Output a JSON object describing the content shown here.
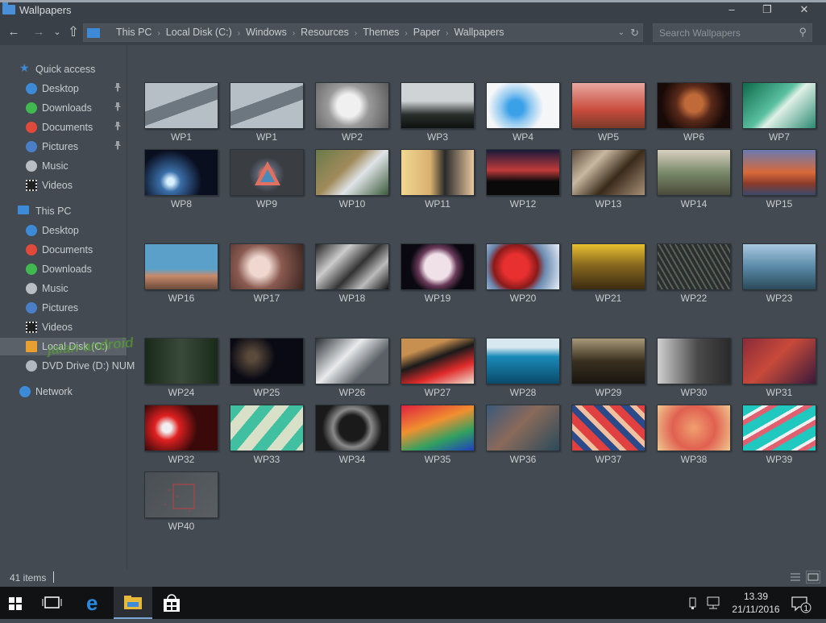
{
  "window": {
    "title": "Wallpapers",
    "minimize": "–",
    "maximize": "❐",
    "close": "✕"
  },
  "nav": {
    "back": "←",
    "forward": "→",
    "recent": "⌄",
    "up": "⇧"
  },
  "address": {
    "crumbs": [
      "This PC",
      "Local Disk (C:)",
      "Windows",
      "Resources",
      "Themes",
      "Paper",
      "Wallpapers"
    ],
    "dropdown": "⌄",
    "refresh": "↻"
  },
  "search": {
    "placeholder": "Search Wallpapers",
    "value": ""
  },
  "sidebar": {
    "quick_access": "Quick access",
    "quick_items": [
      {
        "label": "Desktop",
        "icon": "desktop-icon",
        "pinned": true
      },
      {
        "label": "Downloads",
        "icon": "downloads-icon",
        "pinned": true
      },
      {
        "label": "Documents",
        "icon": "documents-icon",
        "pinned": true
      },
      {
        "label": "Pictures",
        "icon": "pictures-icon",
        "pinned": true
      },
      {
        "label": "Music",
        "icon": "music-icon",
        "pinned": false
      },
      {
        "label": "Videos",
        "icon": "videos-icon",
        "pinned": false
      }
    ],
    "this_pc": "This PC",
    "pc_items": [
      {
        "label": "Desktop",
        "icon": "desktop-icon"
      },
      {
        "label": "Documents",
        "icon": "documents-icon"
      },
      {
        "label": "Downloads",
        "icon": "downloads-icon"
      },
      {
        "label": "Music",
        "icon": "music-icon"
      },
      {
        "label": "Pictures",
        "icon": "pictures-icon"
      },
      {
        "label": "Videos",
        "icon": "videos-icon"
      },
      {
        "label": "Local Disk (C:)",
        "icon": "local-disk-icon",
        "selected": true
      },
      {
        "label": "DVD Drive (D:) NUM",
        "icon": "dvd-drive-icon"
      }
    ],
    "network": "Network",
    "pin_glyph": "📌"
  },
  "files": [
    "WP1",
    "WP1",
    "WP2",
    "WP3",
    "WP4",
    "WP5",
    "WP6",
    "WP7",
    "WP8",
    "WP9",
    "WP10",
    "WP11",
    "WP12",
    "WP13",
    "WP14",
    "WP15",
    "WP16",
    "WP17",
    "WP18",
    "WP19",
    "WP20",
    "WP21",
    "WP22",
    "WP23",
    "WP24",
    "WP25",
    "WP26",
    "WP27",
    "WP28",
    "WP29",
    "WP30",
    "WP31",
    "WP32",
    "WP33",
    "WP34",
    "WP35",
    "WP36",
    "WP37",
    "WP38",
    "WP39",
    "WP40"
  ],
  "watermark": "jalan-android",
  "status": {
    "count": "41 items"
  },
  "taskbar": {
    "time": "13.39",
    "date": "21/11/2016",
    "notifications": "1"
  },
  "colors": {
    "accent": "#3d8ad8",
    "background": "#434a52",
    "chrome": "#3a4047",
    "taskbar": "#101214"
  }
}
